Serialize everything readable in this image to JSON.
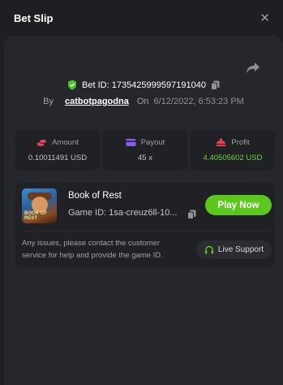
{
  "header": {
    "title": "Bet Slip",
    "close_label": "✕"
  },
  "bet": {
    "id_label": "Bet ID: 1735425999597191040",
    "by_label": "By",
    "username": "catbotpagodna",
    "on_label": "On",
    "date": "6/12/2022, 6:53:23 PM"
  },
  "stats": [
    {
      "label": "Amount",
      "value": "0.10011491 USD",
      "icon": "coins-icon",
      "color": "#e0435a"
    },
    {
      "label": "Payout",
      "value": "45 x",
      "icon": "wallet-icon",
      "color": "#8a5cf0"
    },
    {
      "label": "Profit",
      "value": "4.40505602 USD",
      "icon": "profit-icon",
      "color": "#e0435a",
      "value_color": "#6fd236"
    }
  ],
  "game": {
    "name": "Book of Rest",
    "id_label": "Game ID: 1sa-creuz6ll-10...",
    "thumb_text": "BOOK OF REST",
    "play_label": "Play Now",
    "support_text": "Any issues, please contact the customer service for help and provide the game ID.",
    "support_label": "Live Support"
  },
  "colors": {
    "accent_green": "#5cc81e",
    "shield_green": "#4cc32b",
    "background": "#25272c"
  }
}
